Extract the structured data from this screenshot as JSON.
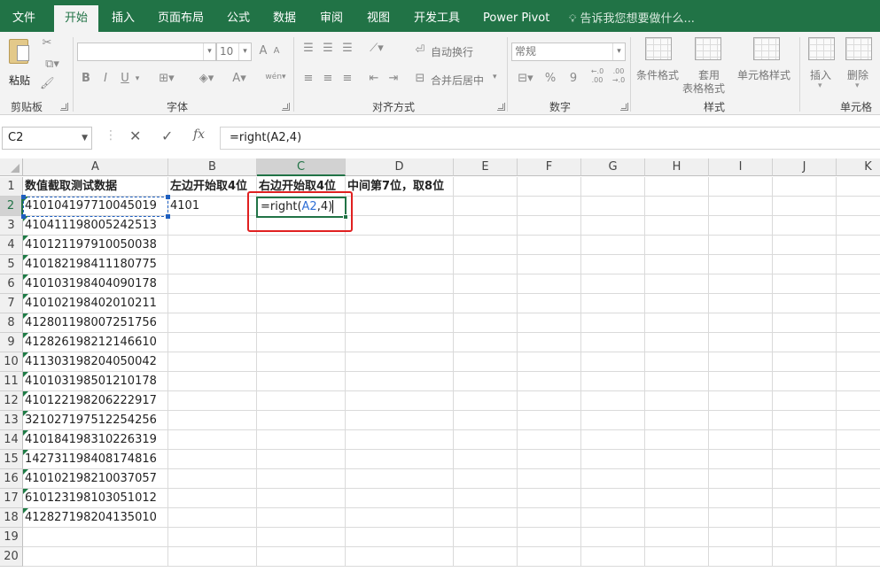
{
  "tabs": [
    "文件",
    "开始",
    "插入",
    "页面布局",
    "公式",
    "数据",
    "审阅",
    "视图",
    "开发工具",
    "Power Pivot"
  ],
  "active_tab": "开始",
  "tell_me": "告诉我您想要做什么...",
  "ribbon": {
    "paste_label": "粘贴",
    "clipboard_group": "剪贴板",
    "font_size": "10",
    "bold": "B",
    "italic": "I",
    "underline": "U",
    "font_color": "A",
    "phonetic": "wén",
    "font_group": "字体",
    "wrap_text": "自动换行",
    "merge_center": "合并后居中",
    "align_group": "对齐方式",
    "number_format": "常规",
    "percent": "%",
    "comma": "9",
    "inc_decimal": "←.0\n.00",
    "dec_decimal": ".00\n→.0",
    "number_group": "数字",
    "cond_format": "条件格式",
    "table_format_1": "套用",
    "table_format_2": "表格格式",
    "cell_styles": "单元格样式",
    "styles_group": "样式",
    "insert": "插入",
    "delete": "删除",
    "cells_group": "单元格"
  },
  "formula_bar": {
    "name_box": "C2",
    "cancel": "✕",
    "enter": "✓",
    "fx": "fx",
    "formula": "=right(A2,4)"
  },
  "columns": [
    "A",
    "B",
    "C",
    "D",
    "E",
    "F",
    "G",
    "H",
    "I",
    "J",
    "K"
  ],
  "selected_column": "C",
  "selected_row": 2,
  "rows": [
    "1",
    "2",
    "3",
    "4",
    "5",
    "6",
    "7",
    "8",
    "9",
    "10",
    "11",
    "12",
    "13",
    "14",
    "15",
    "16",
    "17",
    "18",
    "19",
    "20"
  ],
  "headers": {
    "A": "数值截取测试数据",
    "B": "左边开始取4位",
    "C": "右边开始取4位",
    "D": "中间第7位，取8位"
  },
  "data_A": [
    "410104197710045019",
    "410411198005242513",
    "410121197910050038",
    "410182198411180775",
    "410103198404090178",
    "410102198402010211",
    "412801198007251756",
    "412826198212146610",
    "411303198204050042",
    "410103198501210178",
    "410122198206222917",
    "321027197512254256",
    "410184198310226319",
    "142731198408174816",
    "410102198210037057",
    "610123198103051012",
    "412827198204135010"
  ],
  "B2": "4101",
  "editing": {
    "prefix": "=right(",
    "ref": "A2",
    "suffix": ",4)",
    "ref_color": "#2f6fd6"
  },
  "colors": {
    "accent": "#217346",
    "highlight": "#e02020"
  }
}
